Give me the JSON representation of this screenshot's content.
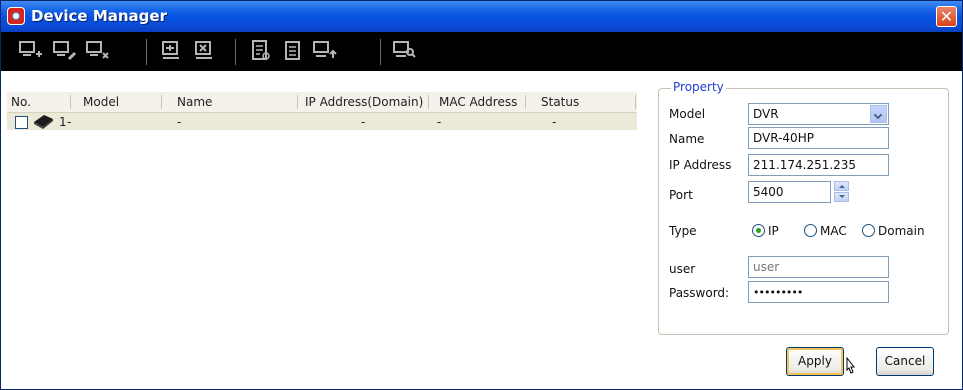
{
  "window": {
    "title": "Device Manager",
    "close_glyph": "✕"
  },
  "toolbar": {
    "icons": [
      "add-device-icon",
      "edit-device-icon",
      "delete-device-icon",
      "connect-icon",
      "disconnect-icon",
      "checklist-icon",
      "document-icon",
      "upload-icon",
      "search-device-icon"
    ]
  },
  "list": {
    "columns": [
      "No.",
      "Model",
      "Name",
      "IP Address(Domain)",
      "MAC Address",
      "Status"
    ],
    "rows": [
      {
        "no": "1",
        "model": "-",
        "name": "-",
        "ip": "-",
        "mac": "-",
        "status": "-"
      }
    ]
  },
  "property": {
    "group_title": "Property",
    "model_label": "Model",
    "model_value": "DVR",
    "name_label": "Name",
    "name_value": "DVR-40HP",
    "ip_label": "IP Address",
    "ip_value": "211.174.251.235",
    "port_label": "Port",
    "port_value": "5400",
    "type_label": "Type",
    "type_options": [
      "IP",
      "MAC",
      "Domain"
    ],
    "type_selected": "IP",
    "user_label": "user",
    "user_placeholder": "user",
    "password_label": "Password:",
    "password_value": "•••••••••"
  },
  "buttons": {
    "apply": "Apply",
    "cancel": "Cancel"
  },
  "colors": {
    "titlebar": "#0551e0",
    "toolbar": "#000000",
    "row_bg": "#ece9d8",
    "group_title": "#1f3fd0"
  }
}
